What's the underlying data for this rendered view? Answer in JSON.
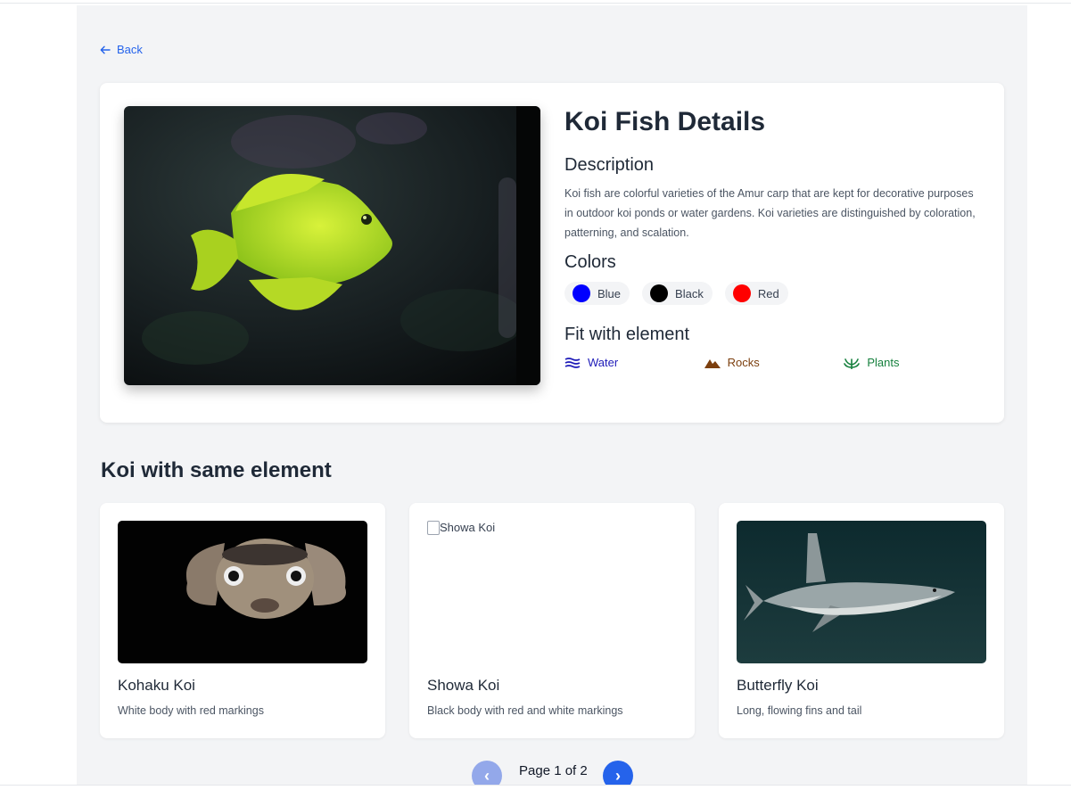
{
  "nav": {
    "back_label": "Back"
  },
  "detail": {
    "title": "Koi Fish Details",
    "description_heading": "Description",
    "description": "Koi fish are colorful varieties of the Amur carp that are kept for decorative purposes in outdoor koi ponds or water gardens. Koi varieties are distinguished by coloration, patterning, and scalation.",
    "colors_heading": "Colors",
    "colors": [
      {
        "label": "Blue",
        "hex": "#0000ff"
      },
      {
        "label": "Black",
        "hex": "#000000"
      },
      {
        "label": "Red",
        "hex": "#ff0000"
      }
    ],
    "elements_heading": "Fit with element",
    "elements": [
      {
        "label": "Water",
        "icon": "water-icon",
        "color": "#1e1bb8"
      },
      {
        "label": "Rocks",
        "icon": "mountain-icon",
        "color": "#7c3f0e"
      },
      {
        "label": "Plants",
        "icon": "plant-icon",
        "color": "#15803d"
      }
    ]
  },
  "related": {
    "heading": "Koi with same element",
    "cards": [
      {
        "name": "Kohaku Koi",
        "subtitle": "White body with red markings"
      },
      {
        "name": "Showa Koi",
        "subtitle": "Black body with red and white markings",
        "alt": "Showa Koi"
      },
      {
        "name": "Butterfly Koi",
        "subtitle": "Long, flowing fins and tail"
      }
    ]
  },
  "pagination": {
    "label": "Page 1 of 2",
    "prev": "‹",
    "next": "›"
  },
  "theme": {
    "accent": "#2563eb",
    "background": "#f3f4f6"
  }
}
